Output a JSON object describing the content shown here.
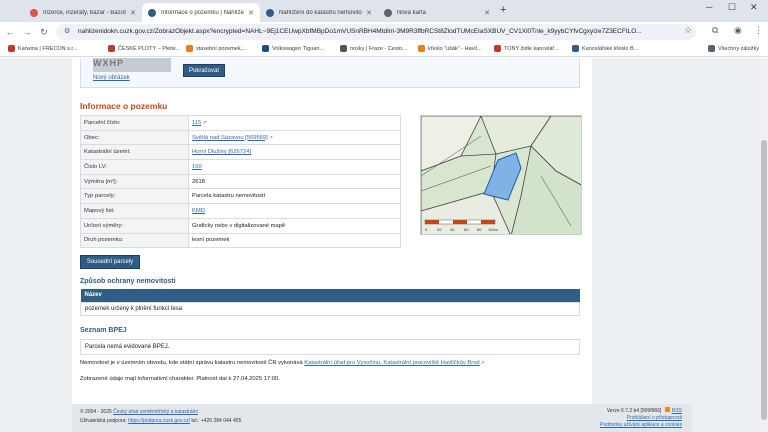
{
  "browser": {
    "tabs": [
      {
        "title": "Inzerce, inzeráty, bazar - Bazoš",
        "favicon_color": "#d9534f",
        "active": false
      },
      {
        "title": "Informace o pozemku | Nahlížení",
        "favicon_color": "#2f5d86",
        "active": true
      },
      {
        "title": "Nahlížení do katastru nemovitostí",
        "favicon_color": "#2f5d86",
        "active": false
      },
      {
        "title": "Nová karta",
        "favicon_color": "#5f6368",
        "active": false
      }
    ],
    "new_tab_label": "+",
    "url": "nahlizenidokn.cuzk.gov.cz/ZobrazObjekt.aspx?encrypted=NAHL~9Ej1CEUwpXbfMBpDo1mVUSnRBH4MtdIm-3M9R3ffbRCSt8ZlodTUMcEIaSXBUV_CV1Xl0Tnle_k9yybCYfvCgxyize7Z3ECFtLO...",
    "bookmarks": [
      {
        "label": "Karwina | FRECON s.r...",
        "color": "#c0392b"
      },
      {
        "label": "ČESKÉ PLOTY – Pletiv...",
        "color": "#c0392b"
      },
      {
        "label": "stavební pozemek,...",
        "color": "#e67e22"
      },
      {
        "label": "Volkswagen Tiguan...",
        "color": "#1a4f8b"
      },
      {
        "label": "nosky | Fraze - Cesto...",
        "color": "#555555"
      },
      {
        "label": "křeslo \"ušák\" - Havlí...",
        "color": "#e67e22"
      },
      {
        "label": "TONY židle kancelář...",
        "color": "#c0392b"
      },
      {
        "label": "Kancelářské křeslo B...",
        "color": "#2f5d86"
      }
    ],
    "all_bookmarks_label": "Všechny záložky"
  },
  "captcha": {
    "image_text": "WXHP",
    "new_image_link": "Nový obrázek",
    "continue_button": "Pokračovat"
  },
  "parcel": {
    "heading": "Informace o pozemku",
    "rows": [
      {
        "key": "Parcelní číslo:",
        "value": "115",
        "link": true,
        "ext": true
      },
      {
        "key": "Obec:",
        "value": "Světlá nad Sázavou [569569]",
        "link": true,
        "ext": true
      },
      {
        "key": "Katastrální území:",
        "value": "Horní Dlužiny [626724]",
        "link": true,
        "ext": false
      },
      {
        "key": "Číslo LV:",
        "value": "160",
        "link": true,
        "ext": false
      },
      {
        "key": "Výměra [m²]:",
        "value": "2618",
        "link": false,
        "ext": false
      },
      {
        "key": "Typ parcely:",
        "value": "Parcela katastru nemovitostí",
        "link": false,
        "ext": false
      },
      {
        "key": "Mapový list:",
        "value": "KMD",
        "link": true,
        "ext": false
      },
      {
        "key": "Určení výměry:",
        "value": "Graficky nebo v digitalizované mapě",
        "link": false,
        "ext": false
      },
      {
        "key": "Druh pozemku:",
        "value": "lesní pozemek",
        "link": false,
        "ext": false
      }
    ],
    "neighbors_button": "Sousední parcely"
  },
  "map": {
    "scale_labels": [
      "0",
      "20",
      "40",
      "60",
      "80",
      "100m"
    ]
  },
  "protection": {
    "heading": "Způsob ochrany nemovitosti",
    "column": "Název",
    "value": "pozemek určený k plnění funkcí lesa"
  },
  "bpej": {
    "heading": "Seznam BPEJ",
    "value": "Parcela nemá evidované BPEJ."
  },
  "notes": {
    "office_prefix": "Nemovitost je v územním obvodu, kde státní správu katastru nemovitostí ČR vykonává",
    "office_link": "Katastrální úřad pro Vysočinu, Katastrální pracoviště Havlíčkův Brod",
    "info_line": "Zobrazené údaje mají informativní charakter. Platnost dat k 27.04.2025 17:00."
  },
  "footer": {
    "copyright_prefix": "© 2004 - 2025",
    "copyright_link": "Český úřad zeměměřický a katastrální",
    "support_prefix": "Uživatelská podpora:",
    "support_link": "https://podpora.cuzk.gov.cz/",
    "support_phone": "tel.: +420 284 044 455",
    "version": "Verze 6.7.2 b4 [909f966]",
    "rss_link": "RSS",
    "accessibility_link": "Prohlášení o přístupnosti",
    "privacy_link": "Podmínky užívání aplikace a cookies"
  }
}
